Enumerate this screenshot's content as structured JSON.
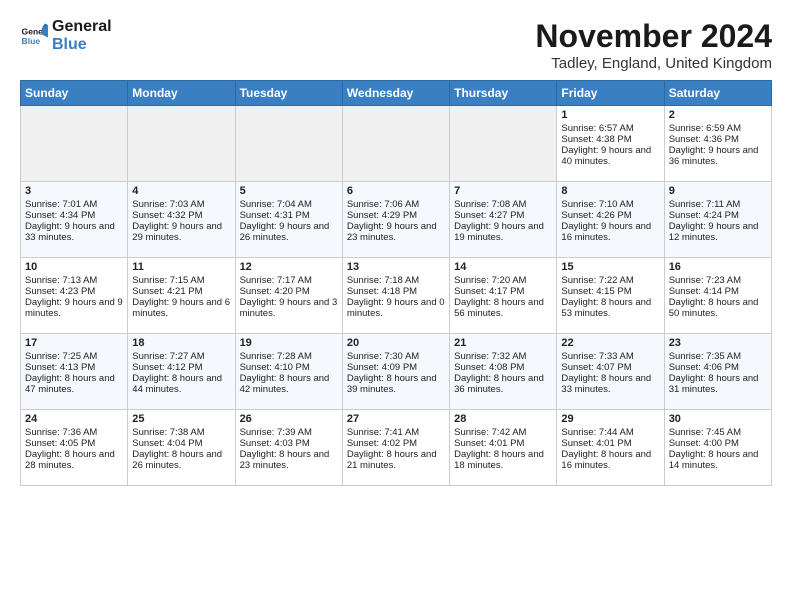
{
  "logo": {
    "line1": "General",
    "line2": "Blue"
  },
  "title": "November 2024",
  "location": "Tadley, England, United Kingdom",
  "headers": [
    "Sunday",
    "Monday",
    "Tuesday",
    "Wednesday",
    "Thursday",
    "Friday",
    "Saturday"
  ],
  "weeks": [
    [
      {
        "day": "",
        "info": ""
      },
      {
        "day": "",
        "info": ""
      },
      {
        "day": "",
        "info": ""
      },
      {
        "day": "",
        "info": ""
      },
      {
        "day": "",
        "info": ""
      },
      {
        "day": "1",
        "info": "Sunrise: 6:57 AM\nSunset: 4:38 PM\nDaylight: 9 hours and 40 minutes."
      },
      {
        "day": "2",
        "info": "Sunrise: 6:59 AM\nSunset: 4:36 PM\nDaylight: 9 hours and 36 minutes."
      }
    ],
    [
      {
        "day": "3",
        "info": "Sunrise: 7:01 AM\nSunset: 4:34 PM\nDaylight: 9 hours and 33 minutes."
      },
      {
        "day": "4",
        "info": "Sunrise: 7:03 AM\nSunset: 4:32 PM\nDaylight: 9 hours and 29 minutes."
      },
      {
        "day": "5",
        "info": "Sunrise: 7:04 AM\nSunset: 4:31 PM\nDaylight: 9 hours and 26 minutes."
      },
      {
        "day": "6",
        "info": "Sunrise: 7:06 AM\nSunset: 4:29 PM\nDaylight: 9 hours and 23 minutes."
      },
      {
        "day": "7",
        "info": "Sunrise: 7:08 AM\nSunset: 4:27 PM\nDaylight: 9 hours and 19 minutes."
      },
      {
        "day": "8",
        "info": "Sunrise: 7:10 AM\nSunset: 4:26 PM\nDaylight: 9 hours and 16 minutes."
      },
      {
        "day": "9",
        "info": "Sunrise: 7:11 AM\nSunset: 4:24 PM\nDaylight: 9 hours and 12 minutes."
      }
    ],
    [
      {
        "day": "10",
        "info": "Sunrise: 7:13 AM\nSunset: 4:23 PM\nDaylight: 9 hours and 9 minutes."
      },
      {
        "day": "11",
        "info": "Sunrise: 7:15 AM\nSunset: 4:21 PM\nDaylight: 9 hours and 6 minutes."
      },
      {
        "day": "12",
        "info": "Sunrise: 7:17 AM\nSunset: 4:20 PM\nDaylight: 9 hours and 3 minutes."
      },
      {
        "day": "13",
        "info": "Sunrise: 7:18 AM\nSunset: 4:18 PM\nDaylight: 9 hours and 0 minutes."
      },
      {
        "day": "14",
        "info": "Sunrise: 7:20 AM\nSunset: 4:17 PM\nDaylight: 8 hours and 56 minutes."
      },
      {
        "day": "15",
        "info": "Sunrise: 7:22 AM\nSunset: 4:15 PM\nDaylight: 8 hours and 53 minutes."
      },
      {
        "day": "16",
        "info": "Sunrise: 7:23 AM\nSunset: 4:14 PM\nDaylight: 8 hours and 50 minutes."
      }
    ],
    [
      {
        "day": "17",
        "info": "Sunrise: 7:25 AM\nSunset: 4:13 PM\nDaylight: 8 hours and 47 minutes."
      },
      {
        "day": "18",
        "info": "Sunrise: 7:27 AM\nSunset: 4:12 PM\nDaylight: 8 hours and 44 minutes."
      },
      {
        "day": "19",
        "info": "Sunrise: 7:28 AM\nSunset: 4:10 PM\nDaylight: 8 hours and 42 minutes."
      },
      {
        "day": "20",
        "info": "Sunrise: 7:30 AM\nSunset: 4:09 PM\nDaylight: 8 hours and 39 minutes."
      },
      {
        "day": "21",
        "info": "Sunrise: 7:32 AM\nSunset: 4:08 PM\nDaylight: 8 hours and 36 minutes."
      },
      {
        "day": "22",
        "info": "Sunrise: 7:33 AM\nSunset: 4:07 PM\nDaylight: 8 hours and 33 minutes."
      },
      {
        "day": "23",
        "info": "Sunrise: 7:35 AM\nSunset: 4:06 PM\nDaylight: 8 hours and 31 minutes."
      }
    ],
    [
      {
        "day": "24",
        "info": "Sunrise: 7:36 AM\nSunset: 4:05 PM\nDaylight: 8 hours and 28 minutes."
      },
      {
        "day": "25",
        "info": "Sunrise: 7:38 AM\nSunset: 4:04 PM\nDaylight: 8 hours and 26 minutes."
      },
      {
        "day": "26",
        "info": "Sunrise: 7:39 AM\nSunset: 4:03 PM\nDaylight: 8 hours and 23 minutes."
      },
      {
        "day": "27",
        "info": "Sunrise: 7:41 AM\nSunset: 4:02 PM\nDaylight: 8 hours and 21 minutes."
      },
      {
        "day": "28",
        "info": "Sunrise: 7:42 AM\nSunset: 4:01 PM\nDaylight: 8 hours and 18 minutes."
      },
      {
        "day": "29",
        "info": "Sunrise: 7:44 AM\nSunset: 4:01 PM\nDaylight: 8 hours and 16 minutes."
      },
      {
        "day": "30",
        "info": "Sunrise: 7:45 AM\nSunset: 4:00 PM\nDaylight: 8 hours and 14 minutes."
      }
    ]
  ]
}
